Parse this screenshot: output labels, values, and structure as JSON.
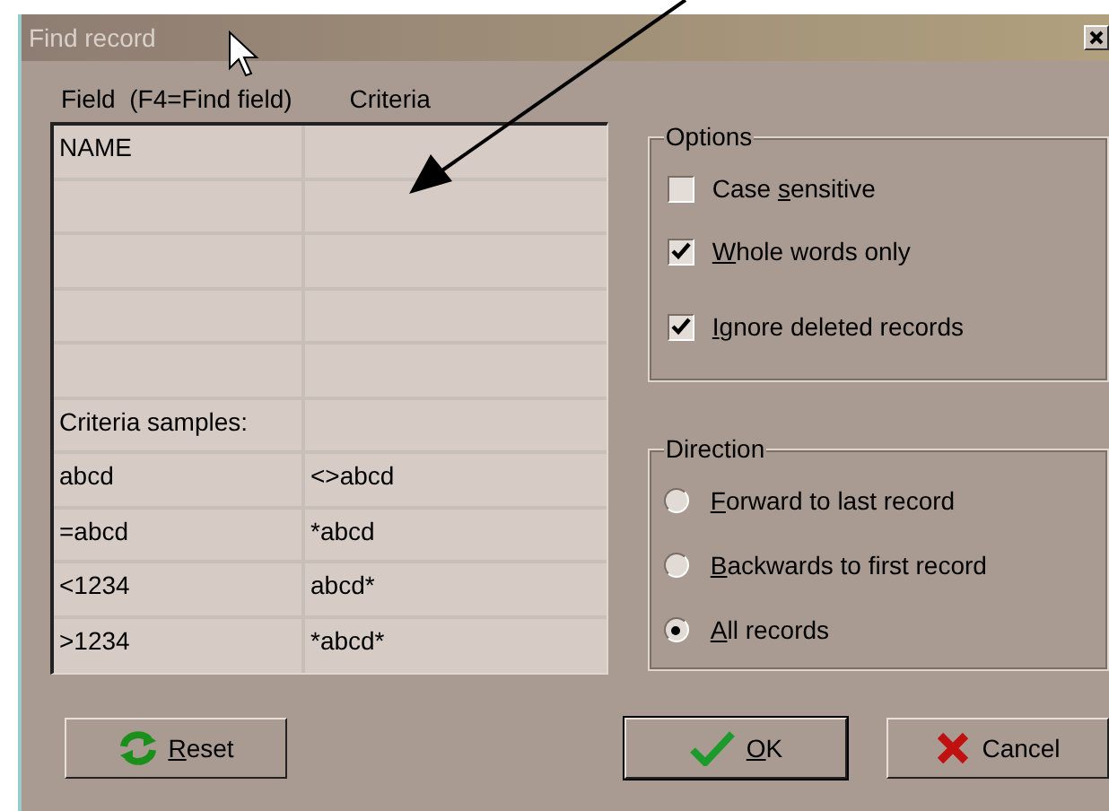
{
  "window": {
    "title": "Find record"
  },
  "grid": {
    "columns": [
      "Field  (F4=Find field)",
      "Criteria"
    ],
    "rows": [
      {
        "field": "NAME"
      },
      {},
      {},
      {},
      {},
      {
        "field": "Criteria samples:"
      },
      {
        "field": "abcd",
        "criteria": "<>abcd"
      },
      {
        "field": "=abcd",
        "criteria": "*abcd"
      },
      {
        "field": "<1234",
        "criteria": "abcd*"
      },
      {
        "field": ">1234",
        "criteria": "*abcd*"
      }
    ]
  },
  "options": {
    "title": "Options",
    "items": [
      {
        "label": {
          "before": "Case ",
          "key": "s",
          "after": "ensitive"
        },
        "checked": false
      },
      {
        "label": {
          "key": "W",
          "after": "hole words only"
        },
        "checked": true
      },
      {
        "label": {
          "key": "I",
          "after": "gnore deleted records"
        },
        "checked": true
      }
    ]
  },
  "direction": {
    "title": "Direction",
    "items": [
      {
        "label": {
          "key": "F",
          "after": "orward to last record"
        },
        "selected": false
      },
      {
        "label": {
          "key": "B",
          "after": "ackwards to first record"
        },
        "selected": false
      },
      {
        "label": {
          "key": "A",
          "after": "ll records"
        },
        "selected": true
      }
    ]
  },
  "buttons": [
    {
      "kind": "reset",
      "label": {
        "key": "R",
        "after": "eset"
      },
      "default": false
    },
    {
      "kind": "ok",
      "label": {
        "key": "O",
        "after": "K"
      },
      "default": true
    },
    {
      "kind": "cancel",
      "label": {
        "before": "Cancel"
      },
      "default": false
    }
  ]
}
